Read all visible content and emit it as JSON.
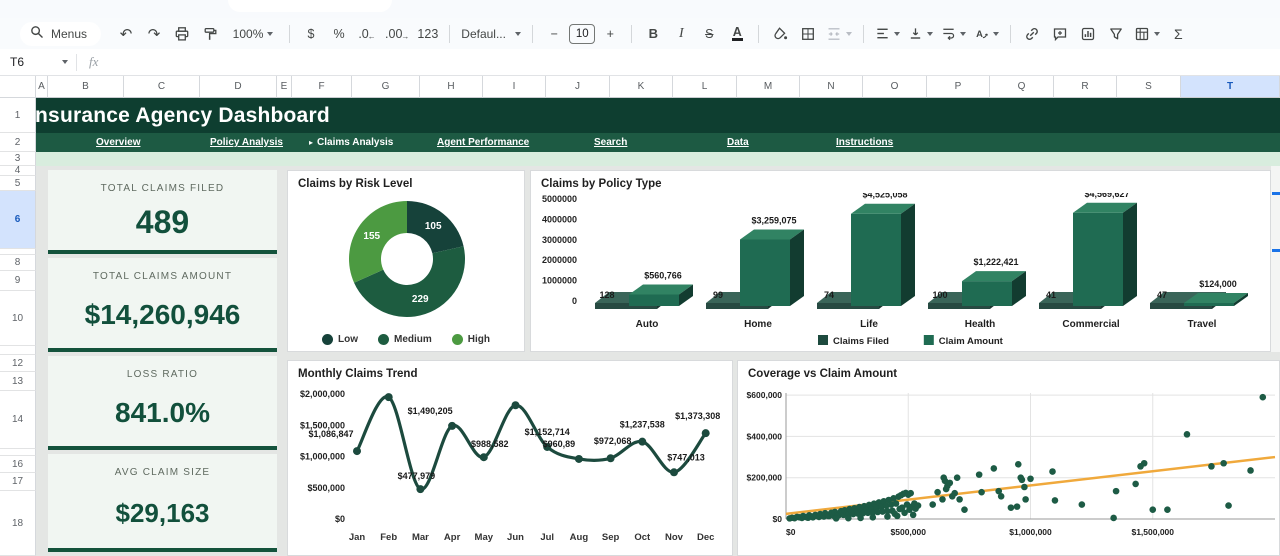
{
  "toolbar": {
    "menus": "Menus",
    "zoom": "100%",
    "currency": "$",
    "percent": "%",
    "decrease_decimals": ".0",
    "increase_decimals": ".00",
    "number_format": "123",
    "font": "Defaul...",
    "minus": "−",
    "font_size": "10",
    "plus": "+",
    "bold": "B",
    "italic": "I",
    "strikethrough": "S",
    "text_color": "A",
    "functions": "Σ"
  },
  "formula_bar": {
    "cell_ref": "T6",
    "fx": "fx"
  },
  "grid": {
    "columns": [
      "A",
      "B",
      "C",
      "D",
      "E",
      "F",
      "G",
      "H",
      "I",
      "J",
      "K",
      "L",
      "M",
      "N",
      "O",
      "P",
      "Q",
      "R",
      "S",
      "T"
    ],
    "selected_column": "T",
    "rows": [
      "1",
      "2",
      "3",
      "4",
      "5",
      "6",
      "",
      "8",
      "9",
      "10",
      "",
      "12",
      "13",
      "14",
      "",
      "16",
      "17",
      "18"
    ],
    "selected_row": "6"
  },
  "header": {
    "title": "Insurance Agency Dashboard",
    "nav": [
      {
        "label": "Overview",
        "active": false
      },
      {
        "label": "Policy Analysis",
        "active": false
      },
      {
        "label": "Claims Analysis",
        "active": true
      },
      {
        "label": "Agent Performance",
        "active": false
      },
      {
        "label": "Search",
        "active": false
      },
      {
        "label": "Data",
        "active": false
      },
      {
        "label": "Instructions",
        "active": false
      }
    ]
  },
  "kpis": [
    {
      "label": "TOTAL CLAIMS FILED",
      "value": "489"
    },
    {
      "label": "TOTAL CLAIMS AMOUNT",
      "value": "$14,260,946"
    },
    {
      "label": "LOSS RATIO",
      "value": "841.0%"
    },
    {
      "label": "AVG CLAIM SIZE",
      "value": "$29,163"
    }
  ],
  "colors": {
    "banner_green": "#0e3e30",
    "nav_green": "#1d5a43",
    "pale_green_strip": "#d8edde",
    "kpi_value_green": "#12503c",
    "kpi_bar_green": "#14533c",
    "selection_blue": "#1a73e8",
    "selected_header_bg": "#d3e3fd",
    "trendline_orange": "#f0a93c"
  },
  "chart_data": [
    {
      "type": "pie",
      "donut": true,
      "title": "Claims by Risk Level",
      "labels": [
        "Low",
        "Medium",
        "High"
      ],
      "values": [
        105,
        229,
        155
      ],
      "slice_colors": [
        "#16423a",
        "#1d5c40",
        "#4c9a41"
      ],
      "legend_position": "bottom"
    },
    {
      "type": "bar",
      "style": "3d",
      "title": "Claims by Policy Type",
      "categories": [
        "Auto",
        "Home",
        "Life",
        "Health",
        "Commercial",
        "Travel"
      ],
      "series": [
        {
          "name": "Claims Filed",
          "values": [
            128,
            99,
            74,
            100,
            41,
            47
          ],
          "color": "#1d4a3e"
        },
        {
          "name": "Claim Amount",
          "values": [
            560766,
            3259075,
            4525058,
            1222421,
            4569627,
            124000
          ],
          "color": "#1f6b52"
        }
      ],
      "count_labels": [
        "128",
        "99",
        "74",
        "100",
        "41",
        "47"
      ],
      "value_labels": [
        "$560,766",
        "$3,259,075",
        "$4,525,058",
        "$1,222,421",
        "$4,569,627",
        "$124,000"
      ],
      "yticks": [
        "5000000",
        "4000000",
        "3000000",
        "2000000",
        "1000000",
        "0"
      ],
      "ylim": [
        0,
        5000000
      ],
      "legend_position": "bottom"
    },
    {
      "type": "line",
      "title": "Monthly Claims Trend",
      "x": [
        "Jan",
        "Feb",
        "Mar",
        "Apr",
        "May",
        "Jun",
        "Jul",
        "Aug",
        "Sep",
        "Oct",
        "Nov",
        "Dec"
      ],
      "values": [
        1086847,
        1950000,
        477979,
        1490205,
        988582,
        1820000,
        1152714,
        960890,
        972068,
        1237538,
        747013,
        1373308
      ],
      "point_labels": [
        "$1,086,847",
        "",
        "$477,979",
        "$1,490,205",
        "$988,582",
        "",
        "$1,152,714",
        "$960,89",
        "$972,068",
        "$1,237,538",
        "$747,013",
        "$1,373,308"
      ],
      "label_dx": [
        -26,
        0,
        -4,
        -22,
        6,
        0,
        0,
        -20,
        2,
        0,
        12,
        -8
      ],
      "label_dy": [
        -14,
        0,
        -10,
        -12,
        -10,
        0,
        -12,
        -12,
        -14,
        -14,
        -12,
        -14
      ],
      "yticks": [
        "$2,000,000",
        "$1,500,000",
        "$1,000,000",
        "$500,000",
        "$0"
      ],
      "ylim": [
        0,
        2000000
      ],
      "line_color": "#1c4a3e",
      "grid": false
    },
    {
      "type": "scatter",
      "title": "Coverage vs Claim Amount",
      "xticks": [
        "$0",
        "$500,000",
        "$1,000,000",
        "$1,500,000"
      ],
      "yticks": [
        "$0",
        "$200,000",
        "$400,000",
        "$600,000"
      ],
      "units": "USD thousands",
      "xlim_k": [
        0,
        2000
      ],
      "ylim_k": [
        0,
        620
      ],
      "point_color": "#1d5b45",
      "grid": true,
      "points_k": [
        [
          15,
          3
        ],
        [
          25,
          6
        ],
        [
          35,
          4
        ],
        [
          45,
          10
        ],
        [
          55,
          8
        ],
        [
          65,
          5
        ],
        [
          70,
          14
        ],
        [
          80,
          10
        ],
        [
          90,
          6
        ],
        [
          95,
          18
        ],
        [
          105,
          12
        ],
        [
          110,
          8
        ],
        [
          120,
          20
        ],
        [
          125,
          15
        ],
        [
          135,
          10
        ],
        [
          140,
          24
        ],
        [
          150,
          18
        ],
        [
          155,
          12
        ],
        [
          160,
          28
        ],
        [
          170,
          20
        ],
        [
          175,
          14
        ],
        [
          185,
          30
        ],
        [
          190,
          22
        ],
        [
          195,
          16
        ],
        [
          200,
          34
        ],
        [
          210,
          25
        ],
        [
          215,
          18
        ],
        [
          225,
          38
        ],
        [
          230,
          28
        ],
        [
          235,
          20
        ],
        [
          240,
          42
        ],
        [
          250,
          30
        ],
        [
          255,
          22
        ],
        [
          260,
          48
        ],
        [
          270,
          34
        ],
        [
          275,
          24
        ],
        [
          280,
          52
        ],
        [
          290,
          38
        ],
        [
          295,
          26
        ],
        [
          300,
          58
        ],
        [
          310,
          42
        ],
        [
          315,
          28
        ],
        [
          320,
          62
        ],
        [
          330,
          46
        ],
        [
          335,
          30
        ],
        [
          340,
          68
        ],
        [
          350,
          50
        ],
        [
          355,
          32
        ],
        [
          360,
          74
        ],
        [
          370,
          55
        ],
        [
          375,
          34
        ],
        [
          380,
          80
        ],
        [
          390,
          60
        ],
        [
          395,
          36
        ],
        [
          400,
          86
        ],
        [
          410,
          64
        ],
        [
          415,
          38
        ],
        [
          420,
          92
        ],
        [
          430,
          70
        ],
        [
          435,
          40
        ],
        [
          440,
          100
        ],
        [
          445,
          25
        ],
        [
          450,
          75
        ],
        [
          455,
          15
        ],
        [
          460,
          108
        ],
        [
          465,
          48
        ],
        [
          470,
          115
        ],
        [
          475,
          55
        ],
        [
          480,
          122
        ],
        [
          485,
          30
        ],
        [
          490,
          126
        ],
        [
          495,
          70
        ],
        [
          500,
          118
        ],
        [
          505,
          45
        ],
        [
          510,
          125
        ],
        [
          515,
          60
        ],
        [
          520,
          20
        ],
        [
          525,
          75
        ],
        [
          530,
          50
        ],
        [
          540,
          65
        ],
        [
          415,
          12
        ],
        [
          355,
          8
        ],
        [
          305,
          5
        ],
        [
          255,
          4
        ],
        [
          205,
          3
        ],
        [
          600,
          70
        ],
        [
          620,
          130
        ],
        [
          640,
          95
        ],
        [
          645,
          200
        ],
        [
          650,
          185
        ],
        [
          655,
          145
        ],
        [
          660,
          160
        ],
        [
          670,
          175
        ],
        [
          680,
          110
        ],
        [
          690,
          125
        ],
        [
          700,
          200
        ],
        [
          710,
          95
        ],
        [
          730,
          45
        ],
        [
          790,
          215
        ],
        [
          800,
          130
        ],
        [
          850,
          245
        ],
        [
          870,
          135
        ],
        [
          880,
          110
        ],
        [
          920,
          55
        ],
        [
          945,
          60
        ],
        [
          950,
          265
        ],
        [
          960,
          200
        ],
        [
          965,
          190
        ],
        [
          975,
          155
        ],
        [
          980,
          95
        ],
        [
          1000,
          195
        ],
        [
          1090,
          230
        ],
        [
          1100,
          90
        ],
        [
          1210,
          70
        ],
        [
          1340,
          5
        ],
        [
          1350,
          135
        ],
        [
          1430,
          170
        ],
        [
          1450,
          255
        ],
        [
          1465,
          270
        ],
        [
          1500,
          45
        ],
        [
          1560,
          45
        ],
        [
          1640,
          410
        ],
        [
          1740,
          255
        ],
        [
          1790,
          270
        ],
        [
          1810,
          65
        ],
        [
          1900,
          235
        ],
        [
          1950,
          590
        ]
      ],
      "trendline": {
        "x1_k": 0,
        "y1_k": 25,
        "x2_k": 2000,
        "y2_k": 300,
        "color": "#f0a93c"
      }
    }
  ]
}
